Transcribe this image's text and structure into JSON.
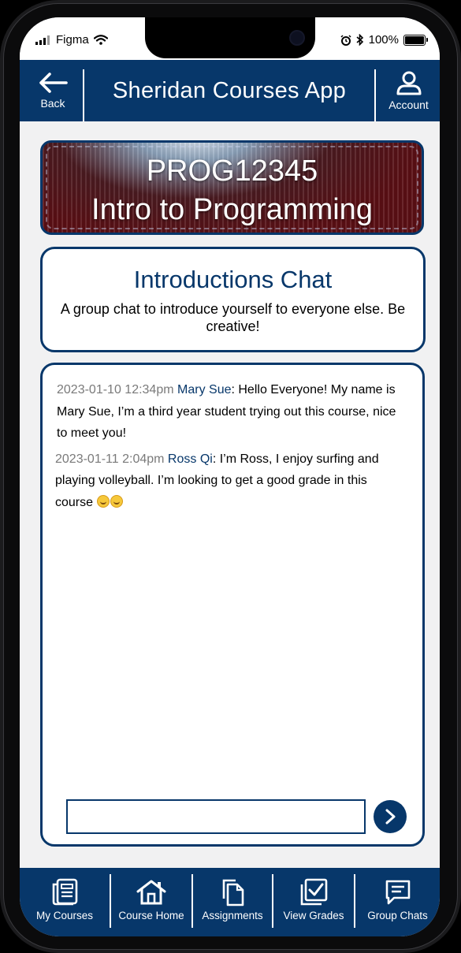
{
  "status_bar": {
    "carrier": "Figma",
    "battery": "100%"
  },
  "header": {
    "back_label": "Back",
    "title": "Sheridan Courses App",
    "account_label": "Account"
  },
  "course": {
    "code": "PROG12345",
    "name": "Intro to Programming"
  },
  "chat": {
    "title": "Introductions Chat",
    "description": "A group chat to introduce yourself to everyone else. Be creative!",
    "messages": [
      {
        "timestamp": "2023-01-10 12:34pm",
        "author": "Mary Sue",
        "text": "Hello Everyone! My name is Mary Sue, I’m a third year student trying out this course, nice to meet you!"
      },
      {
        "timestamp": "2023-01-11 2:04pm",
        "author": "Ross Qi",
        "text": "I’m Ross, I enjoy surfing and playing volleyball. I’m looking to get a good grade in this course"
      }
    ],
    "input_value": ""
  },
  "bottom_nav": {
    "items": [
      {
        "label": "My Courses",
        "icon": "newspaper-icon"
      },
      {
        "label": "Course Home",
        "icon": "home-icon"
      },
      {
        "label": "Assignments",
        "icon": "documents-icon"
      },
      {
        "label": "View Grades",
        "icon": "checkbox-icon"
      },
      {
        "label": "Group Chats",
        "icon": "chat-icon"
      }
    ]
  },
  "colors": {
    "brand": "#07376a",
    "background": "#f1f1f2",
    "timestamp": "#7a7a7a"
  }
}
